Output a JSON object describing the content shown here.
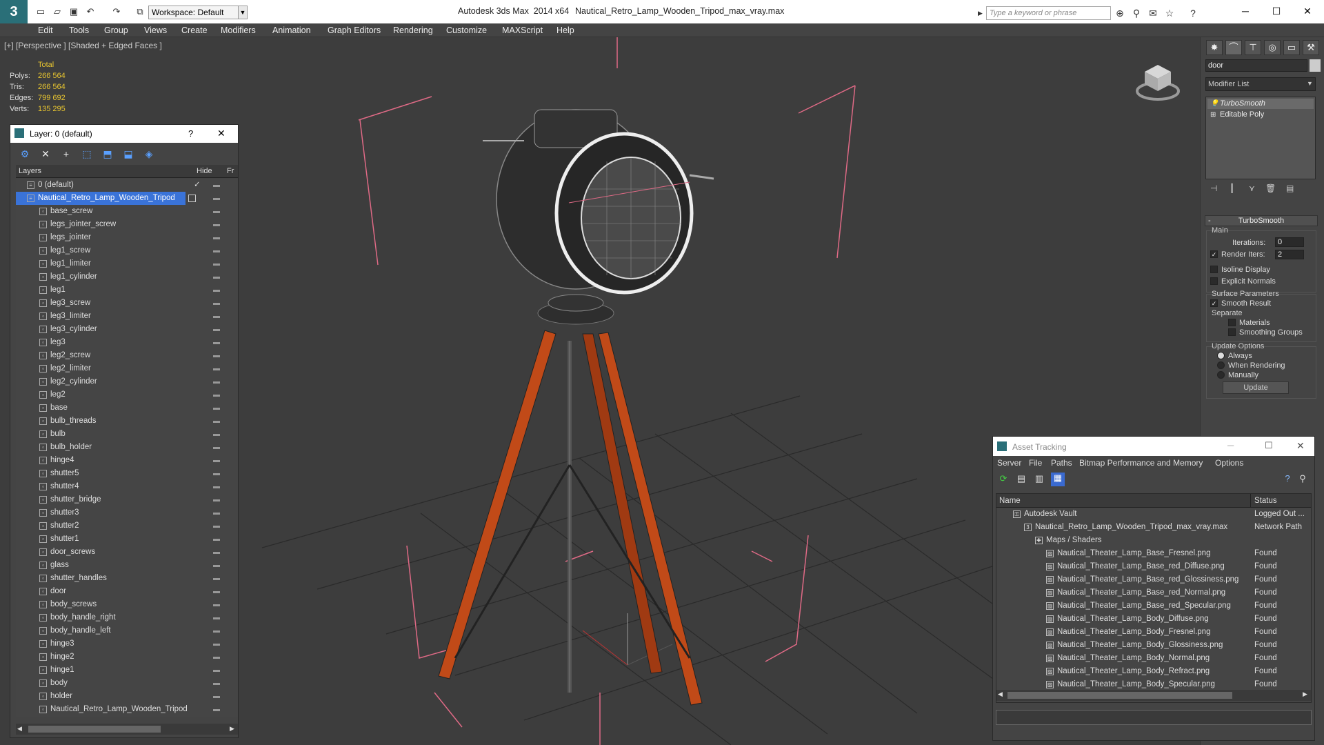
{
  "titlebar": {
    "app_title": "Autodesk 3ds Max  2014 x64",
    "file_title": "Nautical_Retro_Lamp_Wooden_Tripod_max_vray.max",
    "workspace": "Workspace: Default",
    "search_placeholder": "Type a keyword or phrase"
  },
  "menu": [
    "Edit",
    "Tools",
    "Group",
    "Views",
    "Create",
    "Modifiers",
    "Animation",
    "Graph Editors",
    "Rendering",
    "Customize",
    "MAXScript",
    "Help"
  ],
  "viewport": {
    "label": "[+] [Perspective ] [Shaded + Edged Faces ]",
    "stats": {
      "header": "Total",
      "rows": [
        {
          "label": "Polys:",
          "value": "266 564"
        },
        {
          "label": "Tris:",
          "value": "266 564"
        },
        {
          "label": "Edges:",
          "value": "799 692"
        },
        {
          "label": "Verts:",
          "value": "135 295"
        }
      ]
    }
  },
  "layer_window": {
    "title": "Layer: 0 (default)",
    "help": "?",
    "close": "✕",
    "col_layers": "Layers",
    "col_hide": "Hide",
    "col_fr": "Fr",
    "rows": [
      {
        "name": "0 (default)",
        "level": 0
      },
      {
        "name": "Nautical_Retro_Lamp_Wooden_Tripod",
        "level": 0,
        "selected": true
      },
      {
        "name": "base_screw",
        "level": 1
      },
      {
        "name": "legs_jointer_screw",
        "level": 1
      },
      {
        "name": "legs_jointer",
        "level": 1
      },
      {
        "name": "leg1_screw",
        "level": 1
      },
      {
        "name": "leg1_limiter",
        "level": 1
      },
      {
        "name": "leg1_cylinder",
        "level": 1
      },
      {
        "name": "leg1",
        "level": 1
      },
      {
        "name": "leg3_screw",
        "level": 1
      },
      {
        "name": "leg3_limiter",
        "level": 1
      },
      {
        "name": "leg3_cylinder",
        "level": 1
      },
      {
        "name": "leg3",
        "level": 1
      },
      {
        "name": "leg2_screw",
        "level": 1
      },
      {
        "name": "leg2_limiter",
        "level": 1
      },
      {
        "name": "leg2_cylinder",
        "level": 1
      },
      {
        "name": "leg2",
        "level": 1
      },
      {
        "name": "base",
        "level": 1
      },
      {
        "name": "bulb_threads",
        "level": 1
      },
      {
        "name": "bulb",
        "level": 1
      },
      {
        "name": "bulb_holder",
        "level": 1
      },
      {
        "name": "hinge4",
        "level": 1
      },
      {
        "name": "shutter5",
        "level": 1
      },
      {
        "name": "shutter4",
        "level": 1
      },
      {
        "name": "shutter_bridge",
        "level": 1
      },
      {
        "name": "shutter3",
        "level": 1
      },
      {
        "name": "shutter2",
        "level": 1
      },
      {
        "name": "shutter1",
        "level": 1
      },
      {
        "name": "door_screws",
        "level": 1
      },
      {
        "name": "glass",
        "level": 1
      },
      {
        "name": "shutter_handles",
        "level": 1
      },
      {
        "name": "door",
        "level": 1
      },
      {
        "name": "body_screws",
        "level": 1
      },
      {
        "name": "body_handle_right",
        "level": 1
      },
      {
        "name": "body_handle_left",
        "level": 1
      },
      {
        "name": "hinge3",
        "level": 1
      },
      {
        "name": "hinge2",
        "level": 1
      },
      {
        "name": "hinge1",
        "level": 1
      },
      {
        "name": "body",
        "level": 1
      },
      {
        "name": "holder",
        "level": 1
      },
      {
        "name": "Nautical_Retro_Lamp_Wooden_Tripod",
        "level": 1
      }
    ]
  },
  "command_panel": {
    "object_name": "door",
    "modifier_list": "Modifier List",
    "stack": [
      "TurboSmooth",
      "Editable Poly"
    ],
    "rollout_title": "TurboSmooth",
    "main_label": "Main",
    "iterations_label": "Iterations:",
    "iterations_value": "0",
    "render_iters_label": "Render Iters:",
    "render_iters_value": "2",
    "isoline_label": "Isoline Display",
    "explicit_label": "Explicit Normals",
    "surface_label": "Surface Parameters",
    "smooth_result_label": "Smooth Result",
    "separate_label": "Separate",
    "materials_label": "Materials",
    "smoothing_groups_label": "Smoothing Groups",
    "update_options_label": "Update Options",
    "always_label": "Always",
    "when_rendering_label": "When Rendering",
    "manually_label": "Manually",
    "update_button": "Update"
  },
  "asset_window": {
    "title": "Asset Tracking",
    "menu": [
      "Server",
      "File",
      "Paths",
      "Bitmap Performance and Memory",
      "Options"
    ],
    "col_name": "Name",
    "col_status": "Status",
    "rows": [
      {
        "name": "Autodesk Vault",
        "status": "Logged Out ...",
        "indent": 1,
        "icon": "vault"
      },
      {
        "name": "Nautical_Retro_Lamp_Wooden_Tripod_max_vray.max",
        "status": "Network Path",
        "indent": 2,
        "icon": "max"
      },
      {
        "name": "Maps / Shaders",
        "status": "",
        "indent": 3,
        "icon": "maps"
      },
      {
        "name": "Nautical_Theater_Lamp_Base_Fresnel.png",
        "status": "Found",
        "indent": 4,
        "icon": "file"
      },
      {
        "name": "Nautical_Theater_Lamp_Base_red_Diffuse.png",
        "status": "Found",
        "indent": 4,
        "icon": "file"
      },
      {
        "name": "Nautical_Theater_Lamp_Base_red_Glossiness.png",
        "status": "Found",
        "indent": 4,
        "icon": "file"
      },
      {
        "name": "Nautical_Theater_Lamp_Base_red_Normal.png",
        "status": "Found",
        "indent": 4,
        "icon": "file"
      },
      {
        "name": "Nautical_Theater_Lamp_Base_red_Specular.png",
        "status": "Found",
        "indent": 4,
        "icon": "file"
      },
      {
        "name": "Nautical_Theater_Lamp_Body_Diffuse.png",
        "status": "Found",
        "indent": 4,
        "icon": "file"
      },
      {
        "name": "Nautical_Theater_Lamp_Body_Fresnel.png",
        "status": "Found",
        "indent": 4,
        "icon": "file"
      },
      {
        "name": "Nautical_Theater_Lamp_Body_Glossiness.png",
        "status": "Found",
        "indent": 4,
        "icon": "file"
      },
      {
        "name": "Nautical_Theater_Lamp_Body_Normal.png",
        "status": "Found",
        "indent": 4,
        "icon": "file"
      },
      {
        "name": "Nautical_Theater_Lamp_Body_Refract.png",
        "status": "Found",
        "indent": 4,
        "icon": "file"
      },
      {
        "name": "Nautical_Theater_Lamp_Body_Specular.png",
        "status": "Found",
        "indent": 4,
        "icon": "file"
      }
    ]
  }
}
